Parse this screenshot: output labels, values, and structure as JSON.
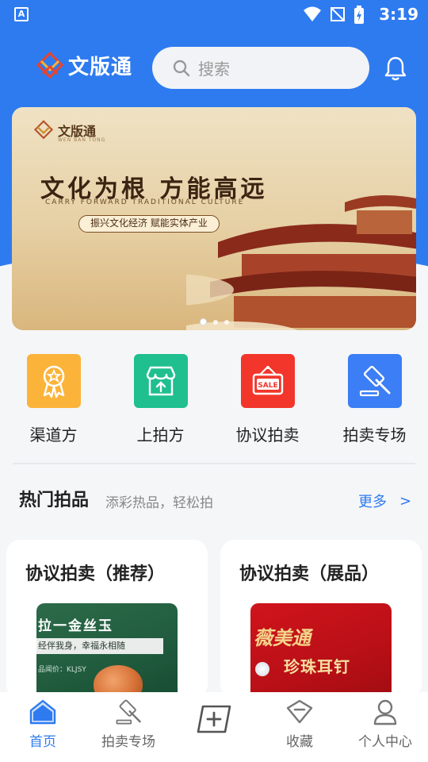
{
  "status_bar": {
    "time": "3:19"
  },
  "header": {
    "app_name": "文版通",
    "search_placeholder": "搜索"
  },
  "banner": {
    "logo_text": "文版通",
    "logo_sub": "WEN BAN TONG",
    "title": "文化为根 方能高远",
    "subtitle_en": "CARRY FORWARD TRADITIONAL CULTURE",
    "slogan": "振兴文化经济 赋能实体产业",
    "slide_count": 3,
    "active_slide": 1
  },
  "quick_actions": [
    {
      "label": "渠道方",
      "icon": "award-icon",
      "color": "#fbb33a"
    },
    {
      "label": "上拍方",
      "icon": "store-upload-icon",
      "color": "#1fbf8f"
    },
    {
      "label": "协议拍卖",
      "icon": "sale-sign-icon",
      "color": "#f2362b"
    },
    {
      "label": "拍卖专场",
      "icon": "gavel-icon",
      "color": "#3b7ef5"
    }
  ],
  "hot_section": {
    "title": "热门拍品",
    "subtitle": "添彩热品，轻松拍",
    "more_label": "更多",
    "more_arrow": ">"
  },
  "cards": [
    {
      "title": "协议拍卖（推荐）",
      "image_title": "拉一金丝玉",
      "image_sub": "经伴我身，幸福永相随",
      "image_price": "品闻价：KLJSY"
    },
    {
      "title": "协议拍卖（展品）",
      "image_title": "薇美通",
      "image_sub": "珍珠耳钉"
    }
  ],
  "bottom_nav": [
    {
      "label": "首页",
      "icon": "home-icon",
      "active": true
    },
    {
      "label": "拍卖专场",
      "icon": "gavel-icon",
      "active": false
    },
    {
      "label": "",
      "icon": "add-message-icon",
      "active": false
    },
    {
      "label": "收藏",
      "icon": "collect-icon",
      "active": false
    },
    {
      "label": "个人中心",
      "icon": "user-icon",
      "active": false
    }
  ],
  "colors": {
    "primary": "#2e7bf0",
    "background": "#f5f6f8"
  }
}
